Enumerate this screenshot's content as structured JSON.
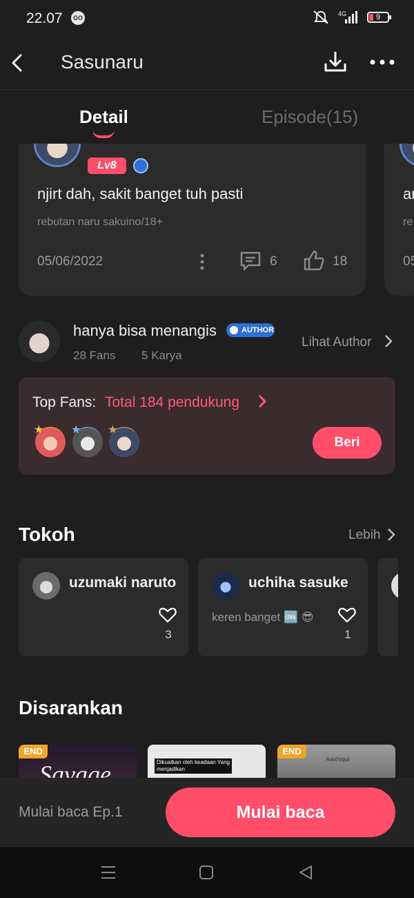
{
  "status_bar": {
    "time": "22.07",
    "badge": "GO",
    "battery": "9",
    "network": "4G"
  },
  "header": {
    "title": "Sasunaru",
    "back_icon": "back-arrow-icon",
    "download_icon": "download-icon",
    "more_icon": "more-icon"
  },
  "tabs": [
    {
      "label": "Detail",
      "active": true
    },
    {
      "label": "Episode(15)",
      "active": false
    }
  ],
  "comment": {
    "level": "Lv8",
    "text": "njirt dah, sakit banget tuh pasti",
    "subtext": "rebutan naru sakuino/18+",
    "date": "05/06/2022",
    "comments": "6",
    "likes": "18"
  },
  "peek_comment": {
    "text": "ar",
    "subtext": "re",
    "date": "05"
  },
  "author": {
    "name": "hanya bisa menangis",
    "badge": "AUTHOR",
    "fans": "28 Fans",
    "works": "5 Karya",
    "link": "Lihat Author"
  },
  "top_fans": {
    "label": "Top Fans:",
    "total": "Total 184 pendukung",
    "button": "Beri"
  },
  "tokoh": {
    "title": "Tokoh",
    "more": "Lebih",
    "characters": [
      {
        "name": "uzumaki naruto",
        "desc": "",
        "likes": "3"
      },
      {
        "name": "uchiha sasuke",
        "desc": "keren banget 🆒 😎",
        "likes": "1"
      }
    ]
  },
  "disarankan": {
    "title": "Disarankan",
    "items": [
      {
        "badge": "END",
        "text": "Savage"
      },
      {
        "badge": "",
        "text": "Dikuatkan oleh keadaan Yang menjadikan"
      },
      {
        "badge": "END",
        "text": "Aashiqui"
      }
    ]
  },
  "bottom": {
    "episode": "Mulai baca Ep.1",
    "button": "Mulai baca"
  },
  "colors": {
    "accent": "#ff4d6a",
    "background": "#1e1e1e",
    "card": "#2b2b2b",
    "fans_card": "#3a2b2e"
  }
}
